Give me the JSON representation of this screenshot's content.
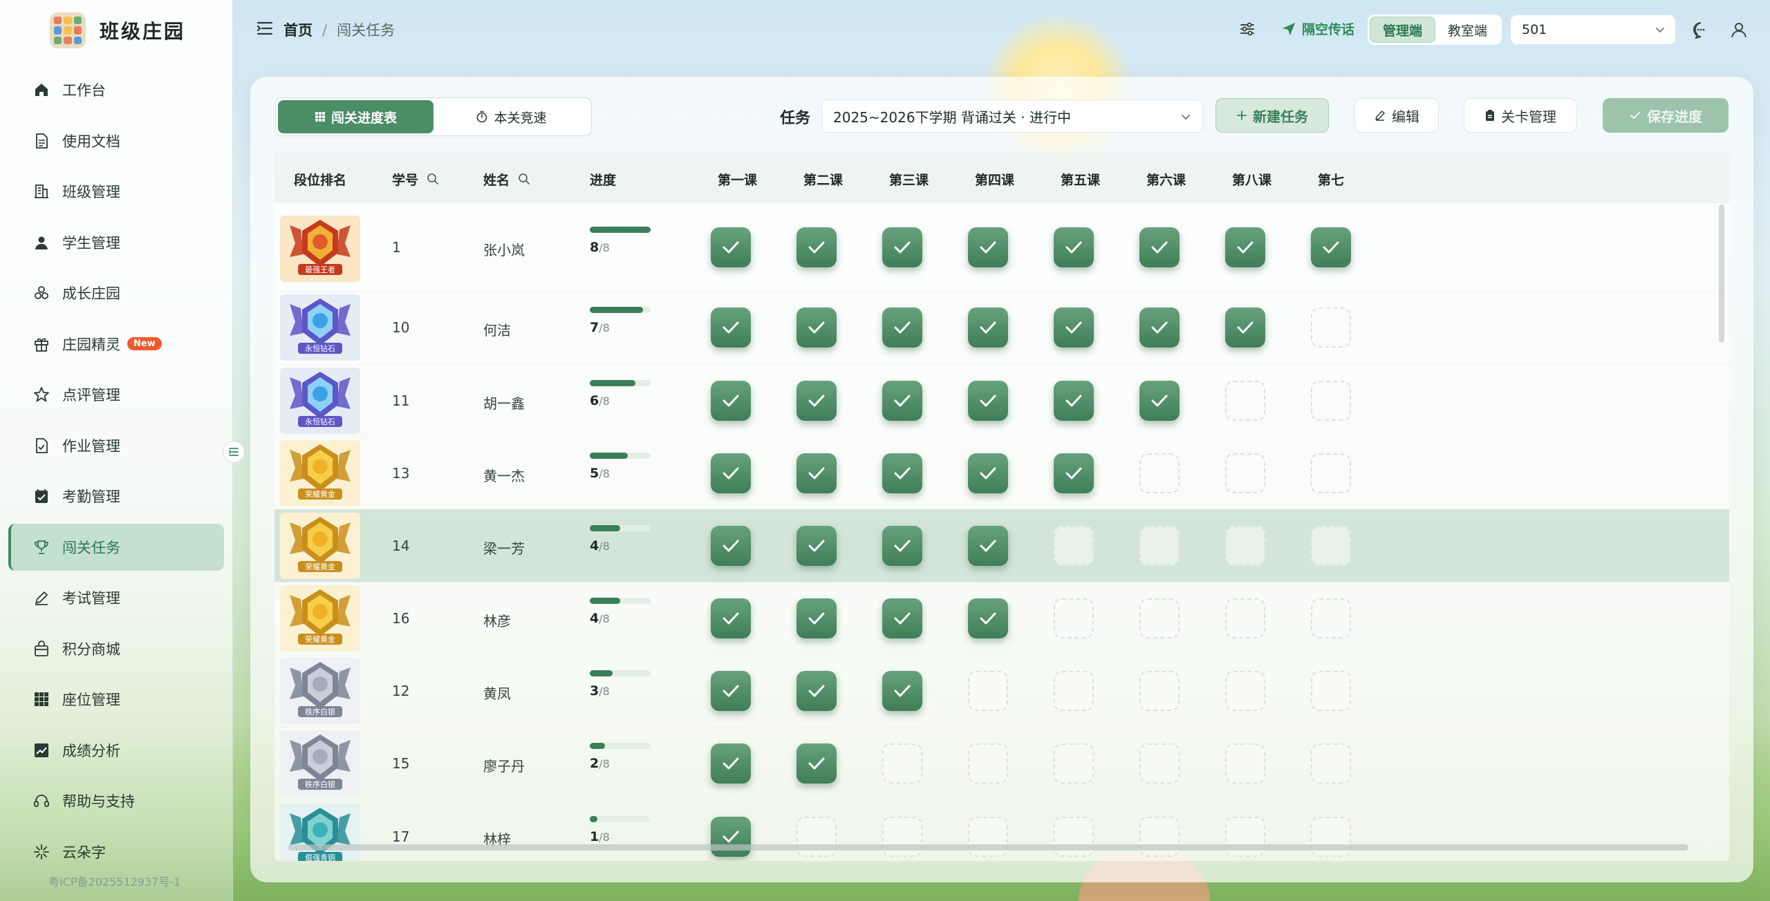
{
  "app": {
    "name": "班级庄园",
    "icp": "粤ICP备2025512937号-1"
  },
  "colors": {
    "accent": "#3d8a5f",
    "new_badge": "#ef5a2c"
  },
  "sidebar": {
    "items": [
      {
        "label": "工作台",
        "icon": "home-icon"
      },
      {
        "label": "使用文档",
        "icon": "document-icon"
      },
      {
        "label": "班级管理",
        "icon": "building-icon"
      },
      {
        "label": "学生管理",
        "icon": "user-icon"
      },
      {
        "label": "成长庄园",
        "icon": "cluster-icon"
      },
      {
        "label": "庄园精灵",
        "icon": "gift-icon",
        "badge": "New"
      },
      {
        "label": "点评管理",
        "icon": "star-icon"
      },
      {
        "label": "作业管理",
        "icon": "file-check-icon"
      },
      {
        "label": "考勤管理",
        "icon": "calendar-check-icon"
      },
      {
        "label": "闯关任务",
        "icon": "trophy-icon",
        "active": true
      },
      {
        "label": "考试管理",
        "icon": "pen-icon"
      },
      {
        "label": "积分商城",
        "icon": "bag-icon"
      },
      {
        "label": "座位管理",
        "icon": "grid-icon"
      },
      {
        "label": "成绩分析",
        "icon": "chart-icon"
      },
      {
        "label": "帮助与支持",
        "icon": "headset-icon"
      },
      {
        "label": "云朵字",
        "icon": "sparkle-icon"
      }
    ]
  },
  "header": {
    "breadcrumb": {
      "home": "首页",
      "separator": "/",
      "current": "闯关任务"
    },
    "send_label": "隔空传话",
    "mode_tabs": [
      "管理端",
      "教室端"
    ],
    "active_mode": "管理端",
    "room_value": "501"
  },
  "toolbar": {
    "view_tabs": [
      "闯关进度表",
      "本关竞速"
    ],
    "task_label": "任务",
    "task_value": "2025~2026下学期 背诵过关 · 进行中",
    "new_task": "新建任务",
    "edit": "编辑",
    "level_manage": "关卡管理",
    "save_progress": "保存进度"
  },
  "table": {
    "columns": [
      "段位排名",
      "学号",
      "姓名",
      "进度",
      "第一课",
      "第二课",
      "第三课",
      "第四课",
      "第五课",
      "第六课",
      "第八课",
      "第七"
    ],
    "total": "/8",
    "rows": [
      {
        "rank": "最强王者",
        "tier": "king",
        "id": "1",
        "name": "张小岚",
        "done": "8",
        "progress": 1.0,
        "lessons": [
          1,
          1,
          1,
          1,
          1,
          1,
          1,
          1
        ]
      },
      {
        "rank": "永恒钻石",
        "tier": "diamond",
        "id": "10",
        "name": "何洁",
        "done": "7",
        "progress": 0.875,
        "lessons": [
          1,
          1,
          1,
          1,
          1,
          1,
          1,
          0
        ]
      },
      {
        "rank": "永恒钻石",
        "tier": "diamond",
        "id": "11",
        "name": "胡一鑫",
        "done": "6",
        "progress": 0.75,
        "lessons": [
          1,
          1,
          1,
          1,
          1,
          1,
          0,
          0
        ]
      },
      {
        "rank": "荣耀黄金",
        "tier": "gold",
        "id": "13",
        "name": "黄一杰",
        "done": "5",
        "progress": 0.625,
        "lessons": [
          1,
          1,
          1,
          1,
          1,
          0,
          0,
          0
        ]
      },
      {
        "rank": "荣耀黄金",
        "tier": "gold",
        "id": "14",
        "name": "梁一芳",
        "done": "4",
        "progress": 0.5,
        "lessons": [
          1,
          1,
          1,
          1,
          0,
          0,
          0,
          0
        ],
        "highlight": true
      },
      {
        "rank": "荣耀黄金",
        "tier": "gold",
        "id": "16",
        "name": "林彦",
        "done": "4",
        "progress": 0.5,
        "lessons": [
          1,
          1,
          1,
          1,
          0,
          0,
          0,
          0
        ]
      },
      {
        "rank": "秩序白银",
        "tier": "silver",
        "id": "12",
        "name": "黄凤",
        "done": "3",
        "progress": 0.375,
        "lessons": [
          1,
          1,
          1,
          0,
          0,
          0,
          0,
          0
        ]
      },
      {
        "rank": "秩序白银",
        "tier": "silver",
        "id": "15",
        "name": "廖子丹",
        "done": "2",
        "progress": 0.25,
        "lessons": [
          1,
          1,
          0,
          0,
          0,
          0,
          0,
          0
        ]
      },
      {
        "rank": "倔强青铜",
        "tier": "bronze",
        "id": "17",
        "name": "林梓",
        "done": "1",
        "progress": 0.125,
        "lessons": [
          1,
          0,
          0,
          0,
          0,
          0,
          0,
          0
        ]
      }
    ]
  }
}
